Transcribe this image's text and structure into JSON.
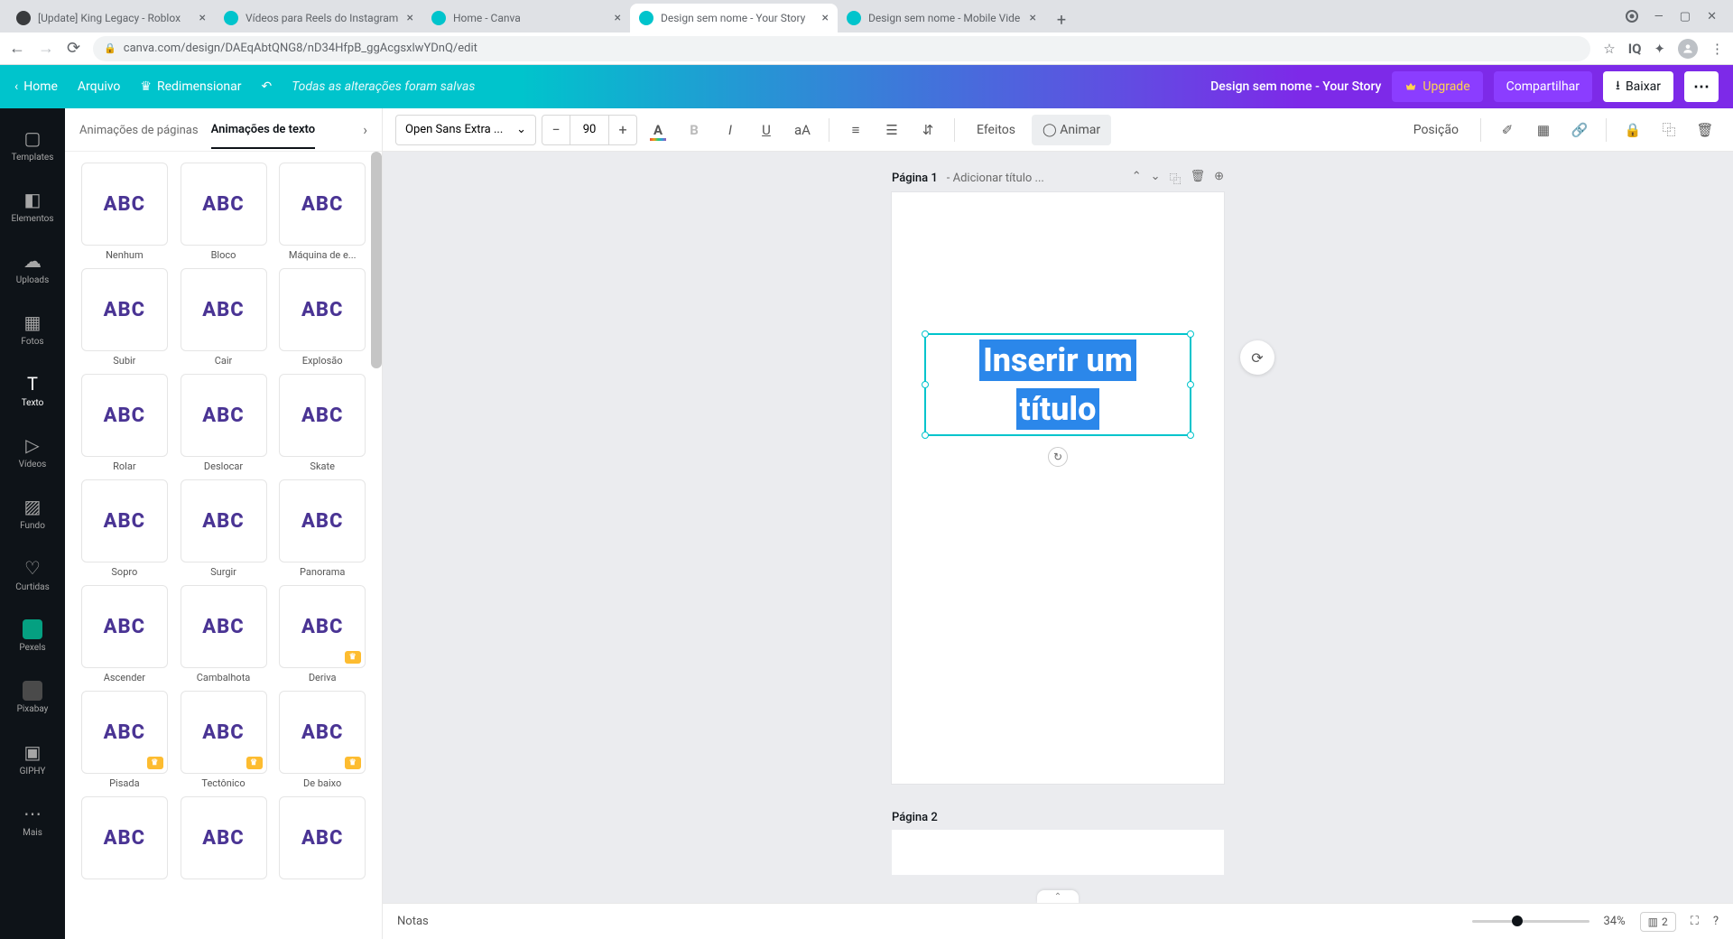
{
  "browser": {
    "tabs": [
      {
        "title": "[Update] King Legacy - Roblox",
        "favicon": "#393b3d"
      },
      {
        "title": "Vídeos para Reels do Instagram",
        "favicon": "#00c4cc"
      },
      {
        "title": "Home - Canva",
        "favicon": "#00c4cc"
      },
      {
        "title": "Design sem nome - Your Story",
        "favicon": "#00c4cc",
        "active": true
      },
      {
        "title": "Design sem nome - Mobile Vide",
        "favicon": "#00c4cc"
      }
    ],
    "url": "canva.com/design/DAEqAbtQNG8/nD34HfpB_ggAcgsxlwYDnQ/edit"
  },
  "header": {
    "home": "Home",
    "arquivo": "Arquivo",
    "redimensionar": "Redimensionar",
    "status": "Todas as alterações foram salvas",
    "project_name": "Design sem nome - Your Story",
    "upgrade": "Upgrade",
    "share": "Compartilhar",
    "download": "Baixar"
  },
  "rail": {
    "templates": "Templates",
    "elementos": "Elementos",
    "uploads": "Uploads",
    "fotos": "Fotos",
    "texto": "Texto",
    "videos": "Vídeos",
    "fundo": "Fundo",
    "curtidas": "Curtidas",
    "pexels": "Pexels",
    "pixabay": "Pixabay",
    "giphy": "GIPHY",
    "mais": "Mais"
  },
  "panel": {
    "tab_pages": "Animações de páginas",
    "tab_text": "Animações de texto",
    "animations": [
      [
        "Nenhum",
        "Bloco",
        "Máquina de e..."
      ],
      [
        "Subir",
        "Cair",
        "Explosão"
      ],
      [
        "Rolar",
        "Deslocar",
        "Skate"
      ],
      [
        "Sopro",
        "Surgir",
        "Panorama"
      ],
      [
        "Ascender",
        "Cambalhota",
        "Deriva"
      ],
      [
        "Pisada",
        "Tectônico",
        "De baixo"
      ],
      [
        "",
        "",
        ""
      ]
    ],
    "premium_rows": [
      4,
      5
    ],
    "premium_single": {
      "row": 4,
      "col": 2
    }
  },
  "toolbar": {
    "font": "Open Sans Extra ...",
    "size": "90",
    "efeitos": "Efeitos",
    "animar": "Animar",
    "posicao": "Posição"
  },
  "canvas": {
    "page1_label": "Página 1",
    "page1_subtitle": " - Adicionar título ...",
    "page2_label": "Página 2",
    "text_line1": "Inserir um",
    "text_line2": "título"
  },
  "footer": {
    "notas": "Notas",
    "zoom": "34%",
    "pages": "2"
  }
}
